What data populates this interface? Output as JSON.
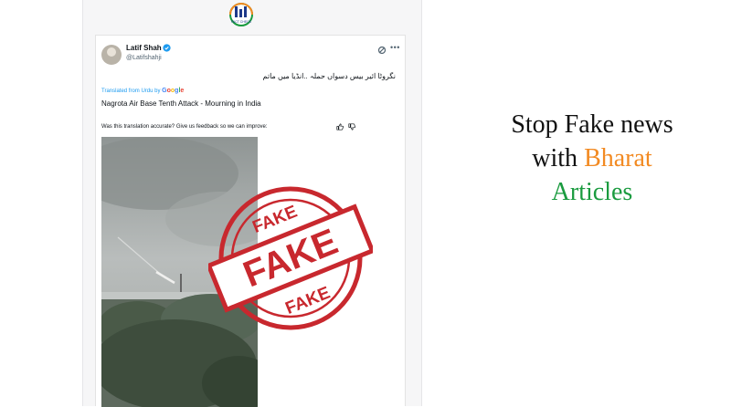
{
  "logo": {
    "text": "FACT CHECK"
  },
  "post": {
    "author_name": "Latif Shah",
    "handle": "@Latifshahji",
    "original_text": "نگروٹا ائیر بیس دسواں حملہ ..انڈیا میں ماتم",
    "translated_from": "Translated from Urdu by",
    "google_label": "Google",
    "translation": "Nagrota Air Base Tenth Attack - Mourning in India",
    "feedback_prompt": "Was this translation accurate? Give us feedback so we can improve:"
  },
  "stamp": {
    "label": "FAKE",
    "color": "#c8282e"
  },
  "headline": {
    "line1": "Stop Fake news",
    "line2_prefix": "with ",
    "line2_brand": "Bharat",
    "line3": "Articles"
  },
  "colors": {
    "accent_orange": "#f28a22",
    "accent_green": "#1a9b3f",
    "stamp_red": "#c8282e",
    "link_blue": "#1d9bf0"
  }
}
